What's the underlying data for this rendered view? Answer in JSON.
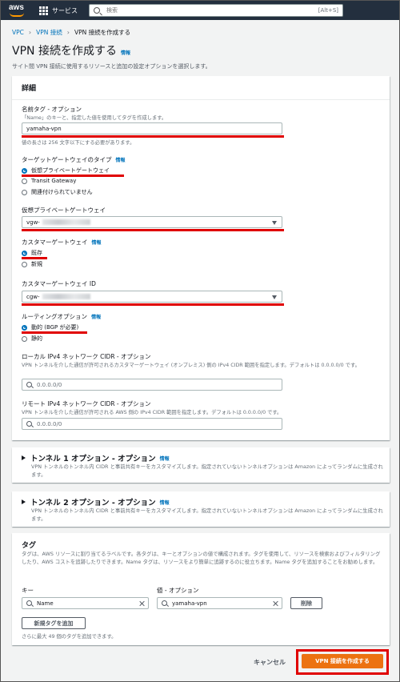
{
  "nav": {
    "logo": "aws",
    "services": "サービス",
    "search_placeholder": "検索",
    "shortcut": "[Alt+S]"
  },
  "breadcrumb": {
    "vpc": "VPC",
    "vpn": "VPN 接続",
    "current": "VPN 接続を作成する"
  },
  "page": {
    "title": "VPN 接続を作成する",
    "info": "情報",
    "subtitle": "サイト間 VPN 接続に使用するリソースと追加の設定オプションを選択します。"
  },
  "details": {
    "heading": "詳細",
    "name_tag_label": "名前タグ - オプション",
    "name_tag_desc": "「Name」のキーと、指定した値を使用してタグを作成します。",
    "name_tag_value": "yamaha-vpn",
    "name_tag_hint": "値の長さは 256 文字以下にする必要があります。",
    "target_gw_label": "ターゲットゲートウェイのタイプ",
    "target_gw_info": "情報",
    "target_gw_options": [
      "仮想プライベートゲートウェイ",
      "Transit Gateway",
      "関連付けられていません"
    ],
    "vgw_label": "仮想プライベートゲートウェイ",
    "vgw_value": "vgw-",
    "cgw_label": "カスタマーゲートウェイ",
    "cgw_info": "情報",
    "cgw_options": [
      "既存",
      "新規"
    ],
    "cgw_id_label": "カスタマーゲートウェイ ID",
    "cgw_id_value": "cgw-",
    "routing_label": "ルーティングオプション",
    "routing_info": "情報",
    "routing_options": [
      "動的 (BGP が必要)",
      "静的"
    ],
    "local_cidr_label": "ローカル IPv4 ネットワーク CIDR - オプション",
    "local_cidr_desc": "VPN トンネルを介した通信が許可されるカスタマーゲートウェイ (オンプレミス) 側の IPv4 CIDR 範囲を指定します。デフォルトは 0.0.0.0/0 です。",
    "local_cidr_placeholder": "0.0.0.0/0",
    "remote_cidr_label": "リモート IPv4 ネットワーク CIDR - オプション",
    "remote_cidr_desc": "VPN トンネルを介した通信が許可される AWS 側の IPv4 CIDR 範囲を指定します。デフォルトは 0.0.0.0/0 です。",
    "remote_cidr_placeholder": "0.0.0.0/0"
  },
  "tunnel1": {
    "title": "トンネル 1 オプション - オプション",
    "info": "情報",
    "desc": "VPN トンネルのトンネル内 CIDR と事前共有キーをカスタマイズします。指定されていないトンネルオプションは Amazon によってランダムに生成されます。"
  },
  "tunnel2": {
    "title": "トンネル 2 オプション - オプション",
    "info": "情報",
    "desc": "VPN トンネルのトンネル内 CIDR と事前共有キーをカスタマイズします。指定されていないトンネルオプションは Amazon によってランダムに生成されます。"
  },
  "tags": {
    "heading": "タグ",
    "desc": "タグは、AWS リソースに割り当てるラベルです。各タグは、キーとオプションの値で構成されます。タグを使用して、リソースを検索およびフィルタリングしたり、AWS コストを追跡したりできます。Name タグは、リソースをより簡単に追跡するのに役立ちます。Name タグを追加することをお勧めします。",
    "key_label": "キー",
    "value_label": "値 - オプション",
    "key_value": "Name",
    "value_value": "yamaha-vpn",
    "remove_label": "削除",
    "add_label": "新規タグを追加",
    "limit_text": "さらに最大 49 個のタグを追加できます。"
  },
  "footer": {
    "cancel": "キャンセル",
    "create": "VPN 接続を作成する"
  },
  "colors": {
    "nav": "#232f3e",
    "link": "#0073bb",
    "primary": "#ec7211",
    "highlight": "#e00000"
  }
}
